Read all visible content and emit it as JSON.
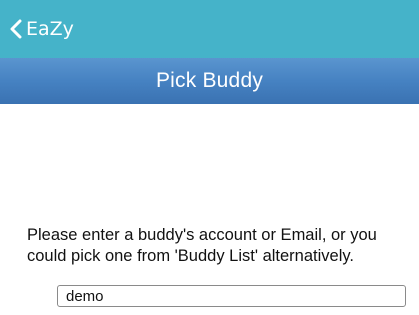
{
  "header": {
    "back_label": "EaZy",
    "back_icon": "chevron-left-icon",
    "title": "Pick Buddy"
  },
  "main": {
    "instructions": "Please enter a buddy's account or Email, or you could pick one from 'Buddy List' alternatively.",
    "buddy_input_value": "demo"
  },
  "colors": {
    "status_bar": "#45b3c9",
    "nav_bar": "#4682c2",
    "text": "#111111"
  }
}
